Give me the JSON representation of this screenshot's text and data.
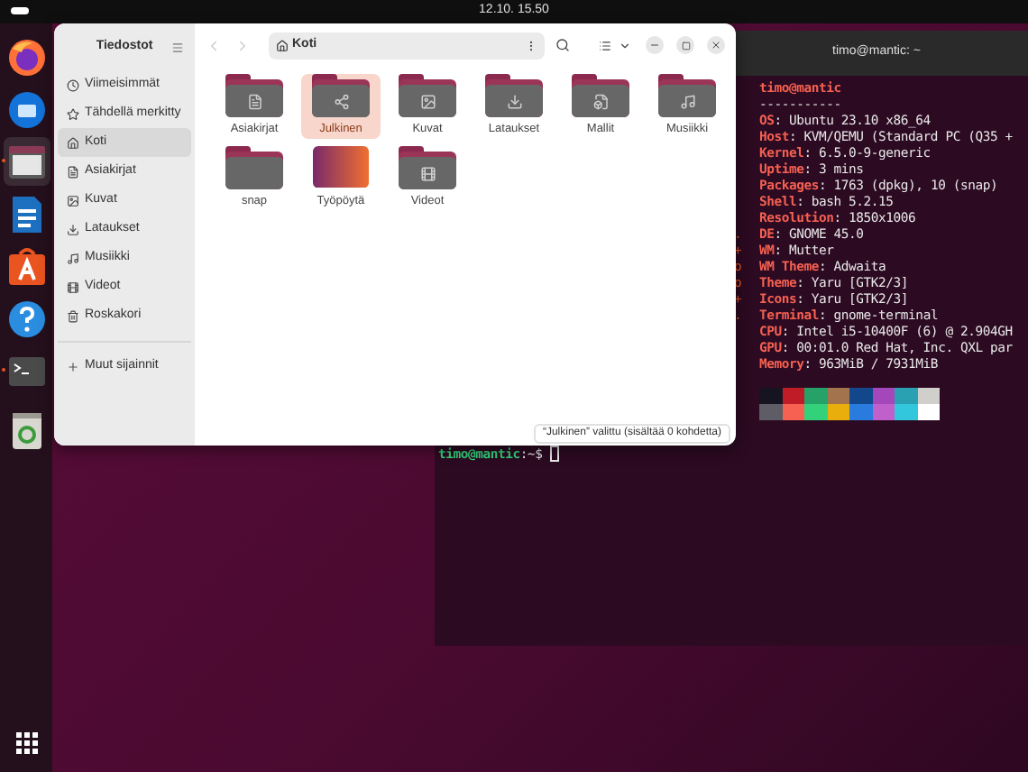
{
  "top_bar": {
    "clock": "12.10. 15.50"
  },
  "dock": {
    "items": [
      {
        "kind": "firefox",
        "running": false
      },
      {
        "kind": "thunderbird",
        "running": false
      },
      {
        "kind": "files",
        "running": true
      },
      {
        "kind": "writer",
        "running": false
      },
      {
        "kind": "appcenter",
        "running": false
      },
      {
        "kind": "help",
        "running": false
      },
      {
        "kind": "terminal",
        "running": true
      },
      {
        "kind": "trash",
        "running": false
      }
    ]
  },
  "files_window": {
    "title": "Tiedostot",
    "path": "Koti",
    "sidebar": {
      "items": [
        {
          "label": "Viimeisimmät",
          "kind": "recent",
          "selected": false
        },
        {
          "label": "Tähdellä merkitty",
          "kind": "starred",
          "selected": false
        },
        {
          "label": "Koti",
          "kind": "home",
          "selected": true
        },
        {
          "label": "Asiakirjat",
          "kind": "documents",
          "selected": false
        },
        {
          "label": "Kuvat",
          "kind": "pictures",
          "selected": false
        },
        {
          "label": "Lataukset",
          "kind": "downloads",
          "selected": false
        },
        {
          "label": "Musiikki",
          "kind": "music",
          "selected": false
        },
        {
          "label": "Videot",
          "kind": "videos",
          "selected": false
        },
        {
          "label": "Roskakori",
          "kind": "trash",
          "selected": false
        }
      ],
      "other_locations": "Muut sijainnit"
    },
    "items": [
      {
        "label": "Asiakirjat",
        "kind": "documents",
        "selected": false
      },
      {
        "label": "Julkinen",
        "kind": "share",
        "selected": true
      },
      {
        "label": "Kuvat",
        "kind": "pictures",
        "selected": false
      },
      {
        "label": "Lataukset",
        "kind": "downloads",
        "selected": false
      },
      {
        "label": "Mallit",
        "kind": "templates",
        "selected": false
      },
      {
        "label": "Musiikki",
        "kind": "music",
        "selected": false
      },
      {
        "label": "snap",
        "kind": "plain",
        "selected": false
      },
      {
        "label": "Työpöytä",
        "kind": "desktop",
        "selected": false
      },
      {
        "label": "Videot",
        "kind": "videos",
        "selected": false
      }
    ],
    "status": "“Julkinen” valittu (sisältää 0 kohdetta)"
  },
  "terminal": {
    "title": "timo@mantic: ~",
    "logo_fragments": [
      ".",
      "+",
      "o",
      "o",
      "+",
      "."
    ],
    "header": "timo@mantic",
    "separator": "-----------",
    "info": [
      {
        "key": "OS",
        "value": ": Ubuntu 23.10 x86_64"
      },
      {
        "key": "Host",
        "value": ": KVM/QEMU (Standard PC (Q35 +"
      },
      {
        "key": "Kernel",
        "value": ": 6.5.0-9-generic"
      },
      {
        "key": "Uptime",
        "value": ": 3 mins"
      },
      {
        "key": "Packages",
        "value": ": 1763 (dpkg), 10 (snap)"
      },
      {
        "key": "Shell",
        "value": ": bash 5.2.15"
      },
      {
        "key": "Resolution",
        "value": ": 1850x1006"
      },
      {
        "key": "DE",
        "value": ": GNOME 45.0"
      },
      {
        "key": "WM",
        "value": ": Mutter"
      },
      {
        "key": "WM Theme",
        "value": ": Adwaita"
      },
      {
        "key": "Theme",
        "value": ": Yaru [GTK2/3]"
      },
      {
        "key": "Icons",
        "value": ": Yaru [GTK2/3]"
      },
      {
        "key": "Terminal",
        "value": ": gnome-terminal"
      },
      {
        "key": "CPU",
        "value": ": Intel i5-10400F (6) @ 2.904GH"
      },
      {
        "key": "GPU",
        "value": ": 00:01.0 Red Hat, Inc. QXL par"
      },
      {
        "key": "Memory",
        "value": ": 963MiB / 7931MiB"
      }
    ],
    "palette": [
      {
        "color": "#171421"
      },
      {
        "color": "#c01c28"
      },
      {
        "color": "#26a269"
      },
      {
        "color": "#a2734c"
      },
      {
        "color": "#12488b"
      },
      {
        "color": "#a347ba"
      },
      {
        "color": "#2aa1b3"
      },
      {
        "color": "#d0cfcc"
      },
      {
        "color": "#5e5c64"
      },
      {
        "color": "#f66151"
      },
      {
        "color": "#33d17a"
      },
      {
        "color": "#e9ad0c"
      },
      {
        "color": "#2a7bde"
      },
      {
        "color": "#c061cb"
      },
      {
        "color": "#33c7de"
      },
      {
        "color": "#ffffff"
      }
    ],
    "prompt": {
      "user": "timo@mantic",
      "path": ":~$"
    }
  }
}
